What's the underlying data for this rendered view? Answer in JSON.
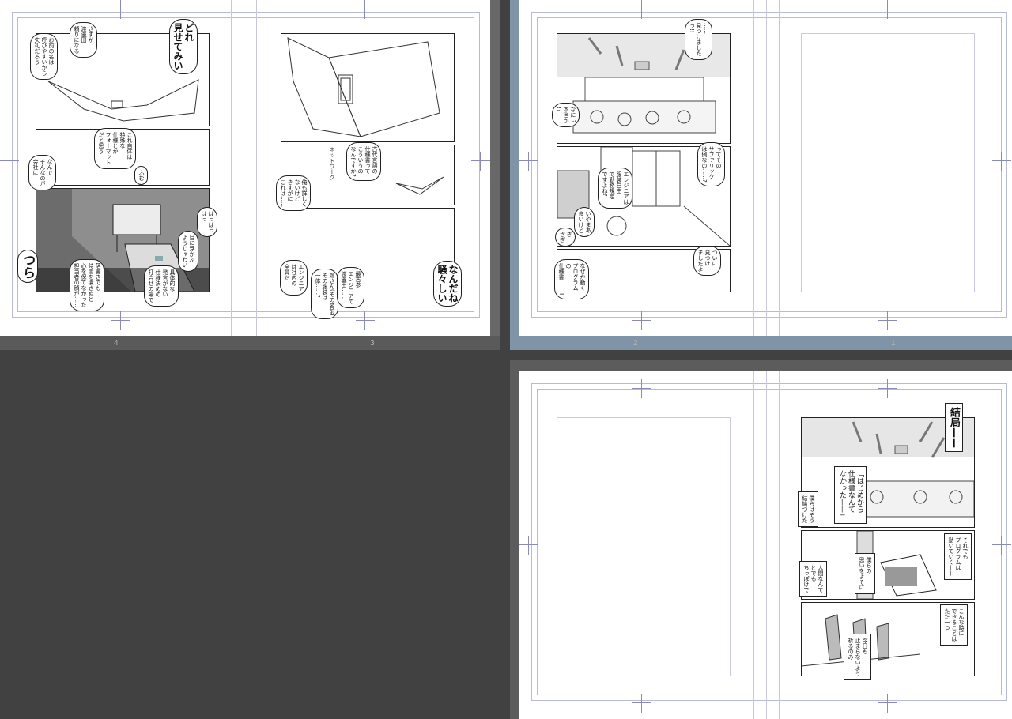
{
  "app": {
    "view": "page-spread-overview",
    "accent_selected": "#7f95a7",
    "background": "#414141"
  },
  "spreads": [
    {
      "name": "spread-4-3",
      "pages": [
        "4",
        "3"
      ],
      "selected": false
    },
    {
      "name": "spread-2-1",
      "pages": [
        "2",
        "1"
      ],
      "selected": true
    },
    {
      "name": "spread-b",
      "pages": [],
      "selected": false
    }
  ],
  "page_numbers": {
    "p4": "4",
    "p3": "3",
    "p2": "2",
    "p1": "1"
  },
  "page4": {
    "b1": "どれ\n見せてみい",
    "b2": "さすが\n渡邊田\n頼りになる",
    "b3": "お前の名は\n呼びやすいから\n失礼だろう",
    "b4": "これ自体は\n特殊な\n仕様とか\nフォーマット\nだと思う",
    "b5": "なんで\nそんなのが\n会社に",
    "b6": "ふむ",
    "b7": "はっはっ\nはっ",
    "b8": "目に浮かぶ\nようじゃわい",
    "b9": "つら",
    "b10": "具体的な\n発言がない\n仕様決めの\n打合せの場で",
    "b11": "落書きでも\n時間を潰さぬと\n心を保てなかった\n担当者の顔が……"
  },
  "page3": {
    "b1": "古代言語の\n仕様書って\nこういうの\nなんですか?",
    "b2": "ネットワーク",
    "b3": "俺も詳しく\nないけど\nきすがに\nこれは……",
    "b4": "鄭さん(その名前)\nその服装は\n一体……?",
    "b5": "最古参\nエンジニアの\n渡邊田……",
    "b6": "エンジニア\nは社内の\n全員だ",
    "b7": "なんだね\n騒々しい"
  },
  "page2": {
    "b1": "……\n見つけました\nっ!!",
    "b2": "なに!?\n本当か\n!?",
    "b3": "ってその\nサファリック\nは例なの……?",
    "b4": "エンジニアは\n服装自由\nで勤務規定\nですよね?",
    "b5": "いやまあ\n良いけど",
    "b6": "ぎ\nさぎ",
    "b7": "ついに\n見つけ\nましたよ",
    "b8": "なぜか動く\nプログラム\nの\n仕様書——!!"
  },
  "page1b": {
    "b1": "結局——",
    "b2": "「はじめから\n仕様書なんて\nなかった——」",
    "b3": "僕らはそう\n結論づけた",
    "b4": "それでも\nプログラムは\n動いていく——",
    "b5": "人間なんて\nとでも\nちっぽけで",
    "b6": "僕らの\n思いをよそに",
    "b7": "こんな時に\nできることは\nただ一つ",
    "b8": "今日も\n止まらないよう\n祈るのみ"
  }
}
